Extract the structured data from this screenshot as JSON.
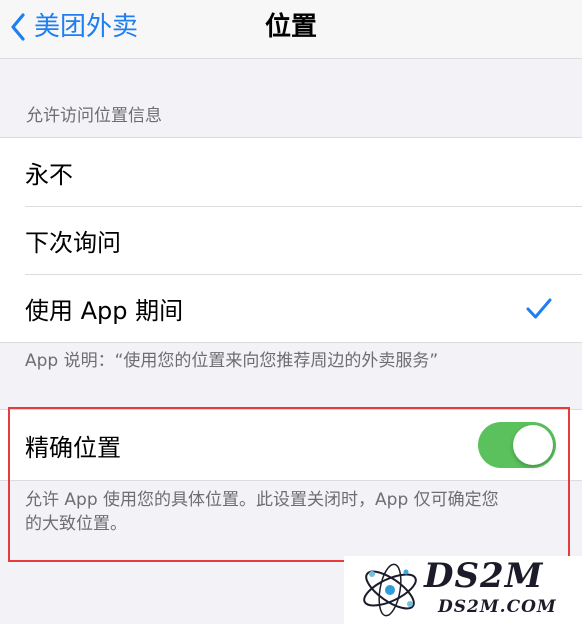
{
  "navbar": {
    "back_label": "美团外卖",
    "title": "位置"
  },
  "location_access": {
    "header": "允许访问位置信息",
    "options": [
      {
        "label": "永不",
        "selected": false
      },
      {
        "label": "下次询问",
        "selected": false
      },
      {
        "label": "使用 App 期间",
        "selected": true
      }
    ],
    "app_note": "App 说明：“使用您的位置来向您推荐周边的外卖服务”"
  },
  "precise_location": {
    "label": "精确位置",
    "enabled": true,
    "description_line1": "允许 App 使用您的具体位置。此设置关闭时，App 仅可确定您",
    "description_line2": "的大致位置。"
  },
  "colors": {
    "accent_blue": "#1f7ef0",
    "toggle_green": "#5ac15d",
    "highlight_red": "#e83b3b",
    "background": "#f2f2f7"
  },
  "watermark": {
    "title": "DS2M",
    "subtitle": "DS2M.COM"
  }
}
